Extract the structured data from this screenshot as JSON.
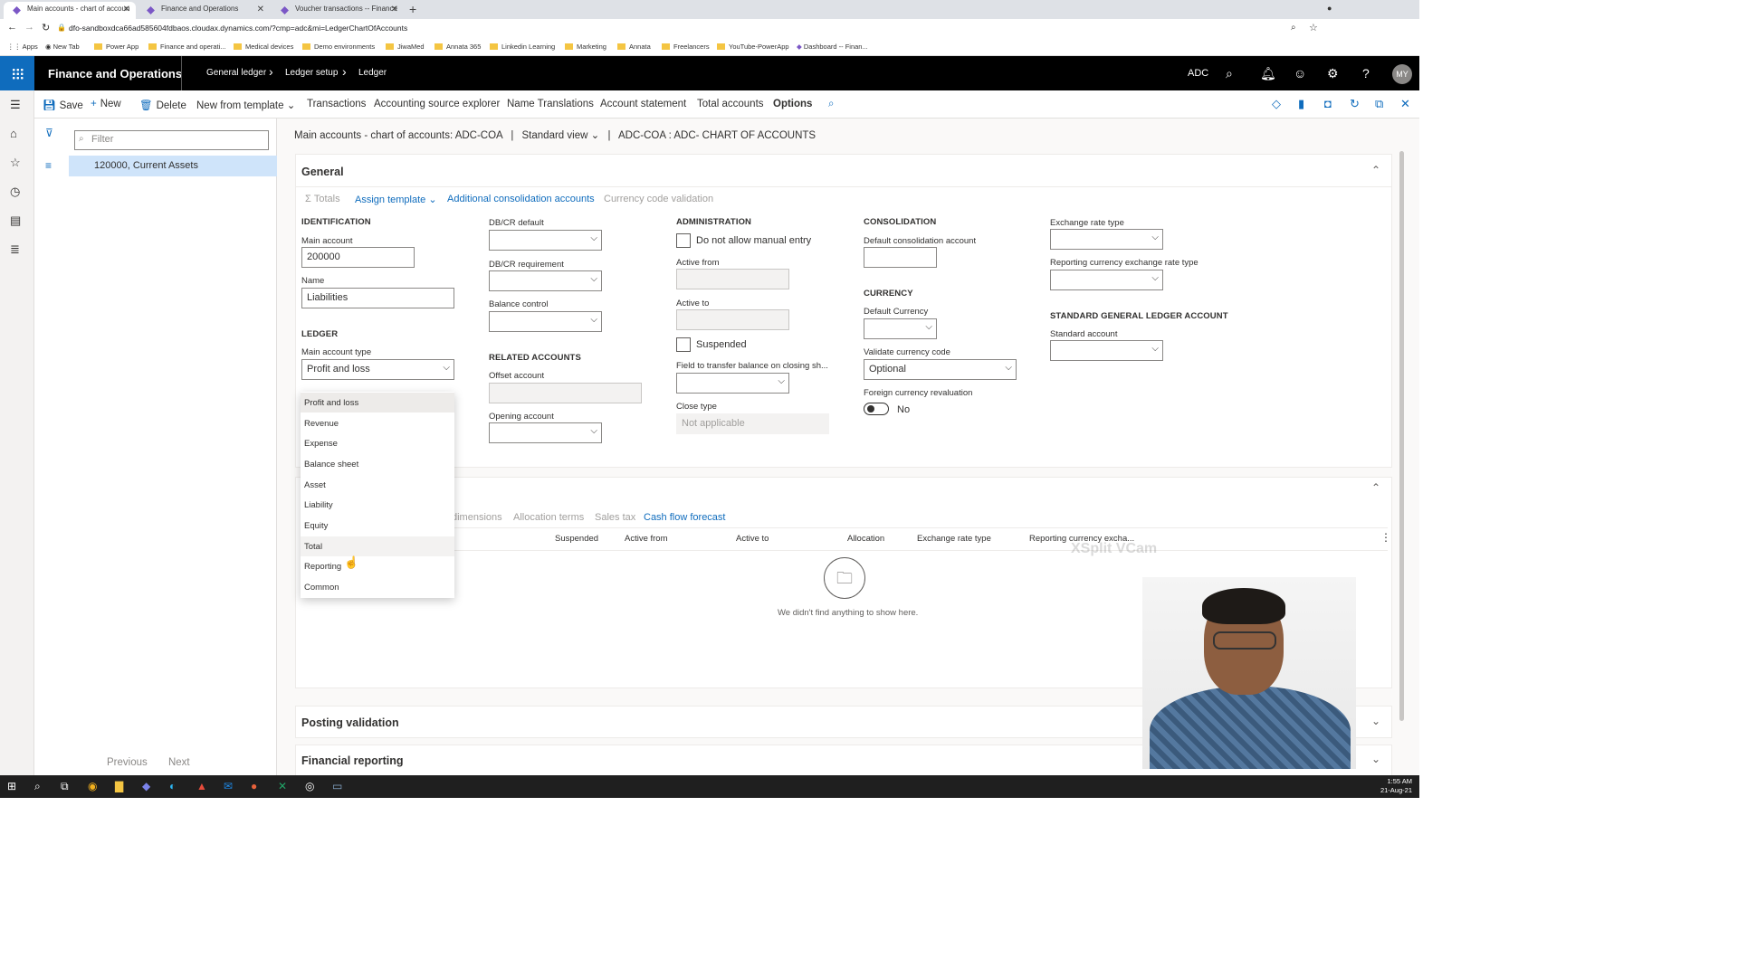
{
  "browser": {
    "tabs": [
      {
        "title": "Main accounts - chart of accoun",
        "active": true
      },
      {
        "title": "Finance and Operations",
        "active": false
      },
      {
        "title": "Voucher transactions -- Finance",
        "active": false
      }
    ],
    "url": "dfo-sandboxdca66ad585604fdbaos.cloudax.dynamics.com/?cmp=adc&mi=LedgerChartOfAccounts",
    "bookmarks": [
      "Apps",
      "New Tab",
      "Power App",
      "Finance and operati...",
      "Medical devices",
      "Demo environments",
      "JiwaMed",
      "Annata 365",
      "Linkedin Learning",
      "Marketing",
      "Annata",
      "Freelancers",
      "YouTube-PowerApp",
      "Dashboard -- Finan..."
    ]
  },
  "app": {
    "title": "Finance and Operations",
    "breadcrumbs": [
      "General ledger",
      "Ledger setup",
      "Ledger"
    ],
    "company": "ADC",
    "avatar": "MY"
  },
  "actions": {
    "save": "Save",
    "new": "New",
    "delete": "Delete",
    "new_from_template": "New from template",
    "transactions": "Transactions",
    "source_explorer": "Accounting source explorer",
    "name_translations": "Name Translations",
    "account_statement": "Account statement",
    "total_accounts": "Total accounts",
    "options": "Options"
  },
  "list": {
    "filter_placeholder": "Filter",
    "selected": "120000, Current Assets",
    "previous": "Previous",
    "next": "Next"
  },
  "caption": {
    "title": "Main accounts - chart of accounts: ADC-COA",
    "view": "Standard view",
    "record": "ADC-COA : ADC- CHART OF ACCOUNTS"
  },
  "general": {
    "title": "General",
    "toolbar": {
      "totals": "Totals",
      "assign_template": "Assign template",
      "additional": "Additional consolidation accounts",
      "currency_validation": "Currency code validation"
    },
    "identification": {
      "heading": "IDENTIFICATION",
      "main_account_label": "Main account",
      "main_account": "200000",
      "name_label": "Name",
      "name": "Liabilities"
    },
    "ledger": {
      "heading": "LEDGER",
      "type_label": "Main account type",
      "type": "Profit and loss",
      "options": [
        "Profit and loss",
        "Revenue",
        "Expense",
        "Balance sheet",
        "Asset",
        "Liability",
        "Equity",
        "Total",
        "Reporting",
        "Common"
      ]
    },
    "dbcr": {
      "default_label": "DB/CR default",
      "requirement_label": "DB/CR requirement",
      "balance_label": "Balance control"
    },
    "related": {
      "heading": "RELATED ACCOUNTS",
      "offset_label": "Offset account",
      "opening_label": "Opening account"
    },
    "administration": {
      "heading": "ADMINISTRATION",
      "no_manual": "Do not allow manual entry",
      "active_from": "Active from",
      "active_to": "Active to",
      "suspended": "Suspended",
      "transfer_label": "Field to transfer balance on closing sh...",
      "close_type_label": "Close type",
      "close_type": "Not applicable"
    },
    "consolidation": {
      "heading": "CONSOLIDATION",
      "default_label": "Default consolidation account"
    },
    "currency": {
      "heading": "CURRENCY",
      "default_label": "Default Currency",
      "validate_label": "Validate currency code",
      "validate": "Optional",
      "reval_label": "Foreign currency revaluation",
      "reval": "No"
    },
    "exchange": {
      "rate_type_label": "Exchange rate type",
      "reporting_label": "Reporting currency exchange rate type"
    },
    "sgl": {
      "heading": "STANDARD GENERAL LEDGER ACCOUNT",
      "standard_label": "Standard account"
    }
  },
  "second": {
    "tabs": [
      "dimensions",
      "Allocation terms",
      "Sales tax",
      "Cash flow forecast"
    ],
    "columns": [
      "Suspended",
      "Active from",
      "Active to",
      "Allocation",
      "Exchange rate type",
      "Reporting currency excha..."
    ],
    "empty": "We didn't find anything to show here."
  },
  "sections": {
    "posting_validation": "Posting validation",
    "financial_reporting": "Financial reporting"
  },
  "overlay": {
    "watermark": "XSplit VCam"
  },
  "taskbar": {
    "time": "1:55 AM",
    "date": "21-Aug-21"
  }
}
